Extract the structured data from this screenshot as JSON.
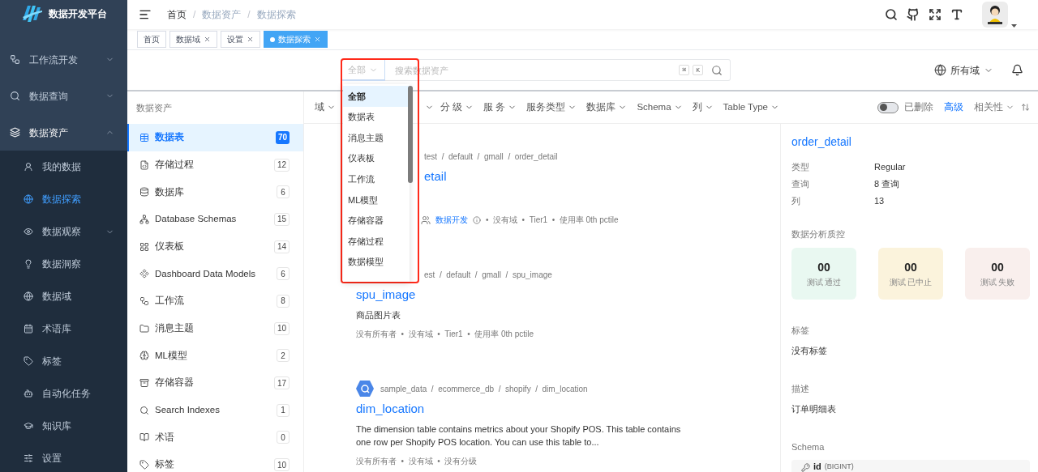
{
  "app": {
    "title": "数据开发平台"
  },
  "sidebar": {
    "items": [
      {
        "label": "工作流开发",
        "expanded": false
      },
      {
        "label": "数据查询",
        "expanded": false
      },
      {
        "label": "数据资产",
        "expanded": true,
        "children": [
          {
            "label": "我的数据",
            "selected": false
          },
          {
            "label": "数据探索",
            "selected": true
          },
          {
            "label": "数据观察",
            "selected": false,
            "expanded": false
          },
          {
            "label": "数据洞察",
            "selected": false
          },
          {
            "label": "数据域",
            "selected": false
          },
          {
            "label": "术语库",
            "selected": false
          },
          {
            "label": "标签",
            "selected": false
          },
          {
            "label": "自动化任务",
            "selected": false
          },
          {
            "label": "知识库",
            "selected": false
          },
          {
            "label": "设置",
            "selected": false
          }
        ]
      }
    ]
  },
  "header": {
    "breadcrumb": [
      "首页",
      "数据资产",
      "数据探索"
    ],
    "separator": "/"
  },
  "tabs": [
    {
      "label": "首页",
      "selected": false,
      "closable": false
    },
    {
      "label": "数据域",
      "selected": false,
      "closable": true
    },
    {
      "label": "设置",
      "selected": false,
      "closable": true
    },
    {
      "label": "数据探索",
      "selected": true,
      "closable": true
    }
  ],
  "search": {
    "scope": "全部",
    "placeholder": "搜索数据资产",
    "shortcut": [
      "⌘",
      "K"
    ],
    "domain": "所有域"
  },
  "scope_menu": {
    "items": [
      {
        "label": "全部",
        "selected": true
      },
      {
        "label": "数据表",
        "selected": false
      },
      {
        "label": "消息主题",
        "selected": false
      },
      {
        "label": "仪表板",
        "selected": false
      },
      {
        "label": "工作流",
        "selected": false
      },
      {
        "label": "ML模型",
        "selected": false
      },
      {
        "label": "存储容器",
        "selected": false
      },
      {
        "label": "存储过程",
        "selected": false
      },
      {
        "label": "数据模型",
        "selected": false
      }
    ]
  },
  "asset_panel": {
    "title": "数据资产",
    "items": [
      {
        "label": "数据表",
        "count": "70",
        "selected": true
      },
      {
        "label": "存储过程",
        "count": "12",
        "selected": false
      },
      {
        "label": "数据库",
        "count": "6",
        "selected": false
      },
      {
        "label": "Database Schemas",
        "count": "15",
        "selected": false
      },
      {
        "label": "仪表板",
        "count": "14",
        "selected": false
      },
      {
        "label": "Dashboard Data Models",
        "count": "6",
        "selected": false
      },
      {
        "label": "工作流",
        "count": "8",
        "selected": false
      },
      {
        "label": "消息主题",
        "count": "10",
        "selected": false
      },
      {
        "label": "ML模型",
        "count": "2",
        "selected": false
      },
      {
        "label": "存储容器",
        "count": "17",
        "selected": false
      },
      {
        "label": "Search Indexes",
        "count": "1",
        "selected": false
      },
      {
        "label": "术语",
        "count": "0",
        "selected": false
      },
      {
        "label": "标签",
        "count": "10",
        "selected": false
      }
    ]
  },
  "filters_before_menu": [
    "域"
  ],
  "filters_after_menu": [
    "分 级",
    "服 务",
    "服务类型",
    "数据库",
    "Schema",
    "列",
    "Table Type"
  ],
  "filter_tools": {
    "deleted_label": "已删除",
    "deleted_on": false,
    "advanced": "高级",
    "sort": "相关性"
  },
  "results": [
    {
      "kind": "behind-menu",
      "breadcrumb": "test  /  default  /  gmall  /  order_detail",
      "title": "etail",
      "owner": "数据开发",
      "meta": "•  没有域  •  Tier1  •  使用率 0th pctile"
    },
    {
      "kind": "crumb-behind-menu",
      "breadcrumb": "est  /  default  /  gmall  /  spu_image",
      "title": "spu_image",
      "description": "商品图片表",
      "meta": "没有所有者  •  没有域  •  Tier1  •  使用率 0th pctile"
    },
    {
      "kind": "full",
      "breadcrumb": "sample_data  /  ecommerce_db  /  shopify  /  dim_location",
      "title": "dim_location",
      "description": "The dimension table contains metrics about your Shopify POS. This table contains one row per Shopify POS location. You can use this table to...",
      "meta": "没有所有者  •  没有域  •  没有分级"
    }
  ],
  "details": {
    "title": "order_detail",
    "properties": [
      {
        "name": "类型",
        "value": "Regular"
      },
      {
        "name": "查询",
        "value": "8 查询"
      },
      {
        "name": "列",
        "value": "13"
      }
    ],
    "quality_title": "数据分析质控",
    "quality": [
      {
        "value": "00",
        "label": "测试 通过",
        "color": "#e9f8f1"
      },
      {
        "value": "00",
        "label": "测试 已中止",
        "color": "#fbf3dc"
      },
      {
        "value": "00",
        "label": "测试 失败",
        "color": "#f9efed"
      }
    ],
    "tags_title": "标签",
    "tags_value": "没有标签",
    "description_title": "描述",
    "description_value": "订单明细表",
    "schema_title": "Schema",
    "schema_column": "id",
    "schema_type": "(BIGINT)"
  }
}
